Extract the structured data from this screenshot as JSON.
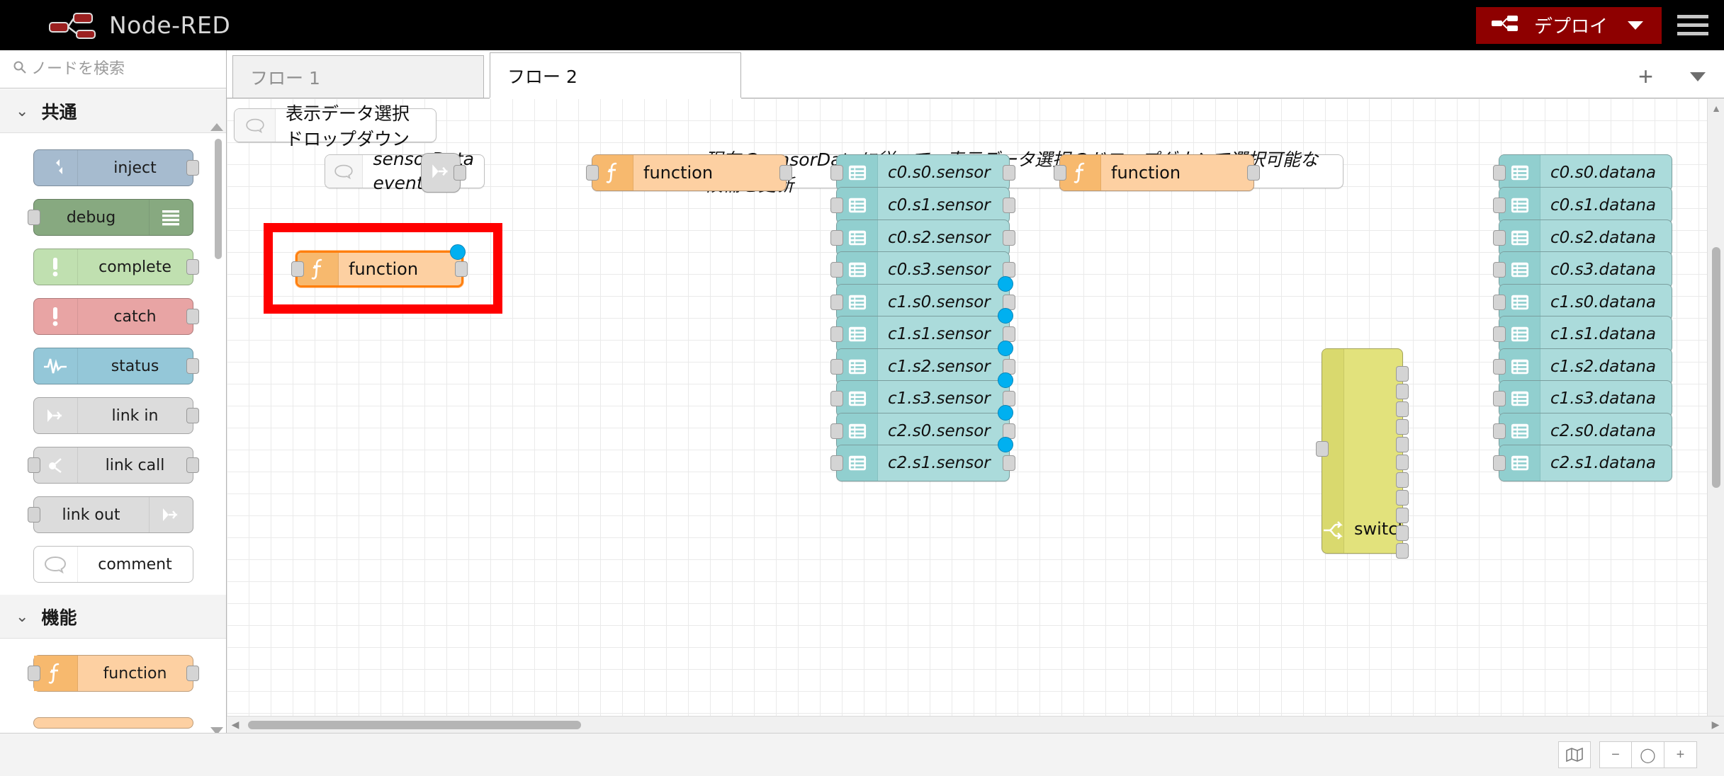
{
  "header": {
    "brand": "Node-RED",
    "logo_icon": "node-red-logo-icon",
    "deploy_label": "デプロイ",
    "deploy_icon": "deploy-flow-icon",
    "deploy_caret_icon": "chevron-down-icon",
    "menu_icon": "hamburger-menu-icon",
    "deploy_color": "#8e0000"
  },
  "palette": {
    "search": {
      "placeholder": "ノードを検索",
      "value": "",
      "icon": "search-icon"
    },
    "categories": [
      {
        "label": "共通",
        "chevron_icon": "chevron-down-icon",
        "nodes": [
          {
            "label": "inject",
            "icon": "inject-icon",
            "color": "#a6bbcf",
            "icon_side": "left",
            "in": false,
            "out": true
          },
          {
            "label": "debug",
            "icon": "debug-list-icon",
            "color": "#87a980",
            "icon_side": "right",
            "in": true,
            "out": false
          },
          {
            "label": "complete",
            "icon": "alert-icon",
            "color": "#c0e0b0",
            "icon_side": "left",
            "in": false,
            "out": true
          },
          {
            "label": "catch",
            "icon": "alert-icon",
            "color": "#e8a4a4",
            "icon_side": "left",
            "in": false,
            "out": true
          },
          {
            "label": "status",
            "icon": "pulse-icon",
            "color": "#94c7d8",
            "icon_side": "left",
            "in": false,
            "out": true
          },
          {
            "label": "link in",
            "icon": "link-in-icon",
            "color": "#dcdcdc",
            "icon_side": "left",
            "in": false,
            "out": true
          },
          {
            "label": "link call",
            "icon": "link-call-icon",
            "color": "#dcdcdc",
            "icon_side": "left",
            "in": true,
            "out": true
          },
          {
            "label": "link out",
            "icon": "link-out-icon",
            "color": "#dcdcdc",
            "icon_side": "right",
            "in": true,
            "out": false
          },
          {
            "label": "comment",
            "icon": "comment-icon",
            "color": "#ffffff",
            "icon_side": "left",
            "in": false,
            "out": false
          }
        ]
      },
      {
        "label": "機能",
        "chevron_icon": "chevron-down-icon",
        "nodes": [
          {
            "label": "function",
            "icon": "function-f-icon",
            "color": "#fdd0a2",
            "icon_side": "left",
            "in": true,
            "out": true
          }
        ]
      }
    ],
    "footer": {
      "collapse_all_icon": "collapse-all-icon",
      "expand_all_icon": "expand-all-icon"
    }
  },
  "tabbar": {
    "tabs": [
      {
        "label": "フロー 1",
        "active": false
      },
      {
        "label": "フロー 2",
        "active": true
      }
    ],
    "add_tab_icon": "plus-icon",
    "tab_menu_icon": "chevron-down-icon"
  },
  "canvas": {
    "comments": [
      {
        "text": "表示データ選択ドロップダウン",
        "icon": "comment-icon",
        "italic": false
      },
      {
        "text": "sensorData event受信",
        "icon": "comment-icon",
        "italic": true
      },
      {
        "text": "現在のsensorDataに従って、表示データ選択のドロップダウンで選択可能な候補を更新",
        "icon": "comment-icon",
        "italic": true
      }
    ],
    "link_in_node": {
      "icon": "link-in-icon"
    },
    "function_nodes": [
      {
        "label": "function",
        "icon": "function-f-icon",
        "selected": false,
        "changed": false
      },
      {
        "label": "function",
        "icon": "function-f-icon",
        "selected": false,
        "changed": false
      },
      {
        "label": "function",
        "icon": "function-f-icon",
        "selected": true,
        "changed": true
      }
    ],
    "switch_node": {
      "label": "switch",
      "icon": "switch-icon",
      "outputs": 12
    },
    "sensor_nodes": [
      {
        "label": "c0.s0.sensor",
        "icon": "debug-list-icon",
        "changed": false
      },
      {
        "label": "c0.s1.sensor",
        "icon": "debug-list-icon",
        "changed": false
      },
      {
        "label": "c0.s2.sensor",
        "icon": "debug-list-icon",
        "changed": false
      },
      {
        "label": "c0.s3.sensor",
        "icon": "debug-list-icon",
        "changed": false
      },
      {
        "label": "c1.s0.sensor",
        "icon": "debug-list-icon",
        "changed": true
      },
      {
        "label": "c1.s1.sensor",
        "icon": "debug-list-icon",
        "changed": true
      },
      {
        "label": "c1.s2.sensor",
        "icon": "debug-list-icon",
        "changed": true
      },
      {
        "label": "c1.s3.sensor",
        "icon": "debug-list-icon",
        "changed": true
      },
      {
        "label": "c2.s0.sensor",
        "icon": "debug-list-icon",
        "changed": true
      },
      {
        "label": "c2.s1.sensor",
        "icon": "debug-list-icon",
        "changed": true
      }
    ],
    "dataname_nodes": [
      {
        "label": "c0.s0.datana",
        "icon": "debug-list-icon"
      },
      {
        "label": "c0.s1.datana",
        "icon": "debug-list-icon"
      },
      {
        "label": "c0.s2.datana",
        "icon": "debug-list-icon"
      },
      {
        "label": "c0.s3.datana",
        "icon": "debug-list-icon"
      },
      {
        "label": "c1.s0.datana",
        "icon": "debug-list-icon"
      },
      {
        "label": "c1.s1.datana",
        "icon": "debug-list-icon"
      },
      {
        "label": "c1.s2.datana",
        "icon": "debug-list-icon"
      },
      {
        "label": "c1.s3.datana",
        "icon": "debug-list-icon"
      },
      {
        "label": "c2.s0.datana",
        "icon": "debug-list-icon"
      },
      {
        "label": "c2.s1.datana",
        "icon": "debug-list-icon"
      }
    ],
    "highlight_color": "#ff0000",
    "selection_color": "#ff7f0e",
    "status_dot_color": "#00b0f0",
    "scrollbar": {
      "left_arrow_icon": "caret-left-icon",
      "right_arrow_icon": "caret-right-icon",
      "up_arrow_icon": "caret-up-icon",
      "down_arrow_icon": "caret-down-icon"
    }
  },
  "statusbar": {
    "buttons": [
      {
        "icon": "map-icon",
        "label": ""
      },
      {
        "icon": "zoom-out-icon",
        "label": ""
      },
      {
        "icon": "zoom-reset-icon",
        "label": ""
      },
      {
        "icon": "zoom-in-icon",
        "label": ""
      }
    ]
  }
}
